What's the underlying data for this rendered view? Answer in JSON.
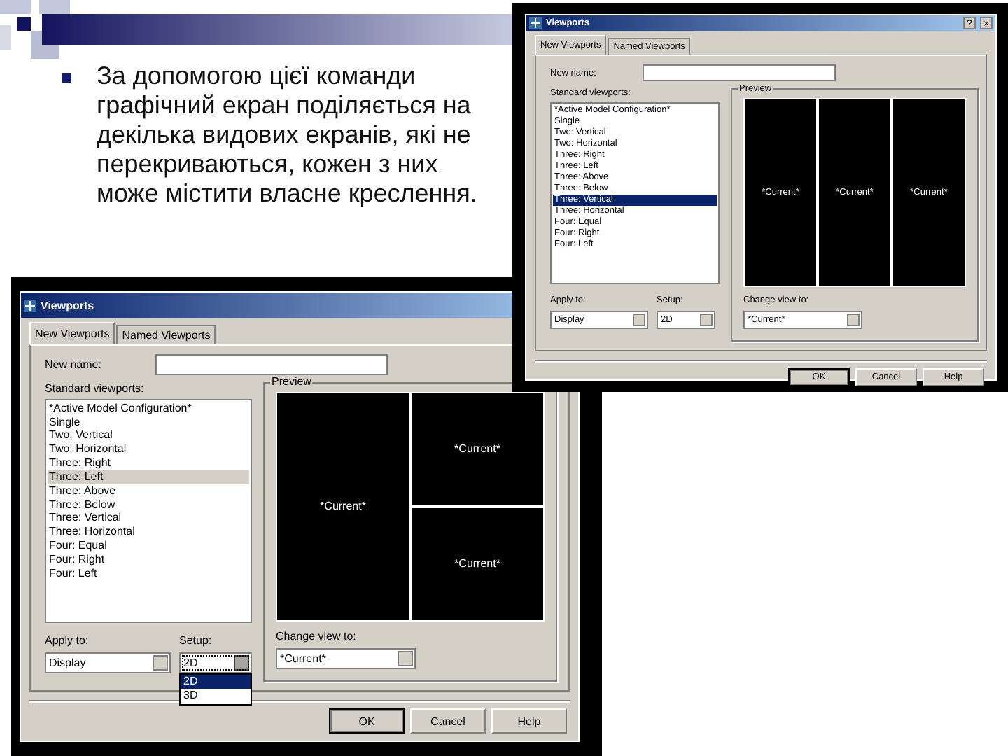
{
  "slide": {
    "bullet": "За допомогою цієї команди графічний екран поділяється на декілька видових екранів, які не перекриваються, кожен з них може містити власне креслення."
  },
  "dialogs": [
    {
      "title": "Viewports",
      "title_buttons": [
        "?",
        "×"
      ],
      "tabs": [
        {
          "label": "New Viewports",
          "selected": true
        },
        {
          "label": "Named Viewports",
          "selected": false
        }
      ],
      "new_name": {
        "label": "New name:"
      },
      "list_label": "Standard viewports:",
      "list_focused": true,
      "viewports": [
        {
          "label": "*Active Model Configuration*",
          "selected": false
        },
        {
          "label": "Single",
          "selected": false
        },
        {
          "label": "Two: Vertical",
          "selected": false
        },
        {
          "label": "Two: Horizontal",
          "selected": false
        },
        {
          "label": "Three: Right",
          "selected": false
        },
        {
          "label": "Three: Left",
          "selected": false
        },
        {
          "label": "Three: Above",
          "selected": false
        },
        {
          "label": "Three: Below",
          "selected": false
        },
        {
          "label": "Three: Vertical",
          "selected": true
        },
        {
          "label": "Three: Horizontal",
          "selected": false
        },
        {
          "label": "Four: Equal",
          "selected": false
        },
        {
          "label": "Four: Right",
          "selected": false
        },
        {
          "label": "Four: Left",
          "selected": false
        }
      ],
      "preview": {
        "label": "Preview",
        "pane_columns": [
          [
            "*Current*"
          ],
          [
            "*Current*"
          ],
          [
            "*Current*"
          ]
        ]
      },
      "apply_to": {
        "label": "Apply to:",
        "value": "Display"
      },
      "setup": {
        "label": "Setup:",
        "value": "2D",
        "open": false
      },
      "change_view": {
        "label": "Change view to:",
        "value": "*Current*"
      },
      "buttons": [
        "OK",
        "Cancel",
        "Help"
      ]
    },
    {
      "title": "Viewports",
      "tabs": [
        {
          "label": "New Viewports",
          "selected": true
        },
        {
          "label": "Named Viewports",
          "selected": false
        }
      ],
      "new_name": {
        "label": "New name:"
      },
      "list_label": "Standard viewports:",
      "list_focused": false,
      "viewports": [
        {
          "label": "*Active Model Configuration*",
          "selected": false
        },
        {
          "label": "Single",
          "selected": false
        },
        {
          "label": "Two: Vertical",
          "selected": false
        },
        {
          "label": "Two: Horizontal",
          "selected": false
        },
        {
          "label": "Three: Right",
          "selected": false
        },
        {
          "label": "Three: Left",
          "selected": true
        },
        {
          "label": "Three: Above",
          "selected": false
        },
        {
          "label": "Three: Below",
          "selected": false
        },
        {
          "label": "Three: Vertical",
          "selected": false
        },
        {
          "label": "Three: Horizontal",
          "selected": false
        },
        {
          "label": "Four: Equal",
          "selected": false
        },
        {
          "label": "Four: Right",
          "selected": false
        },
        {
          "label": "Four: Left",
          "selected": false
        }
      ],
      "preview": {
        "label": "Preview",
        "pane_columns": [
          [
            "*Current*"
          ],
          [
            "*Current*",
            "*Current*"
          ]
        ]
      },
      "apply_to": {
        "label": "Apply to:",
        "value": "Display"
      },
      "setup": {
        "label": "Setup:",
        "value": "2D",
        "open": true,
        "options": [
          {
            "label": "2D",
            "selected": true
          },
          {
            "label": "3D",
            "selected": false
          }
        ]
      },
      "change_view": {
        "label": "Change view to:",
        "value": "*Current*"
      },
      "buttons": [
        "OK",
        "Cancel",
        "Help"
      ]
    }
  ]
}
